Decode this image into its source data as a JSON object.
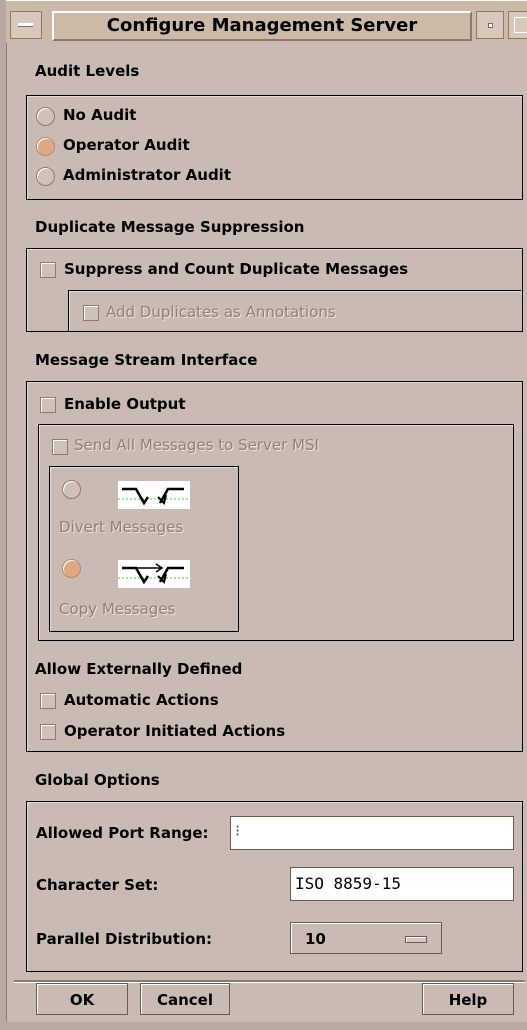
{
  "window": {
    "title": "Configure Management Server"
  },
  "audit": {
    "label": "Audit Levels",
    "options": [
      "No Audit",
      "Operator Audit",
      "Administrator Audit"
    ],
    "selected": "Operator Audit"
  },
  "duplicate": {
    "label": "Duplicate Message Suppression",
    "suppress_label": "Suppress and Count Duplicate Messages",
    "annotations_label": "Add Duplicates as Annotations"
  },
  "msi": {
    "label": "Message Stream Interface",
    "enable_output_label": "Enable Output",
    "send_all_label": "Send All Messages to Server MSI",
    "divert_label": "Divert Messages",
    "copy_label": "Copy Messages",
    "selected_mode": "Copy Messages",
    "allow_label": "Allow Externally Defined",
    "automatic_label": "Automatic Actions",
    "operator_initiated_label": "Operator Initiated Actions"
  },
  "global": {
    "label": "Global Options",
    "port_range_label": "Allowed Port Range:",
    "port_range_value": "",
    "charset_label": "Character Set:",
    "charset_value": "ISO 8859-15",
    "parallel_label": "Parallel Distribution:",
    "parallel_value": "10"
  },
  "buttons": {
    "ok": "OK",
    "cancel": "Cancel",
    "help": "Help"
  }
}
